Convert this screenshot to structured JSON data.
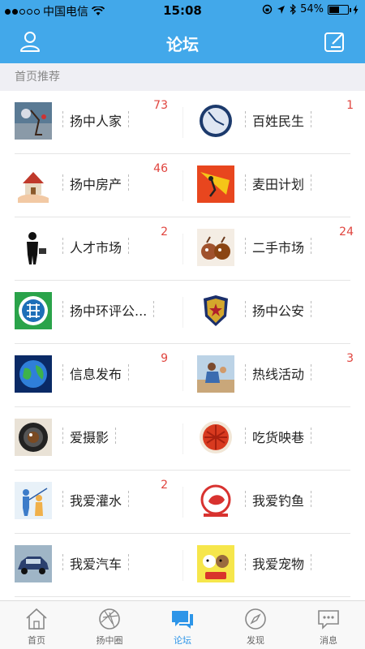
{
  "status": {
    "carrier": "中国电信",
    "time": "15:08",
    "battery": "54%",
    "battery_level": 0.54
  },
  "header": {
    "title": "论坛"
  },
  "section": {
    "title": "首页推荐"
  },
  "forums": [
    {
      "label": "扬中人家",
      "count": "73"
    },
    {
      "label": "百姓民生",
      "count": "1"
    },
    {
      "label": "扬中房产",
      "count": "46"
    },
    {
      "label": "麦田计划",
      "count": ""
    },
    {
      "label": "人才市场",
      "count": "2"
    },
    {
      "label": "二手市场",
      "count": "24"
    },
    {
      "label": "扬中环评公...",
      "count": ""
    },
    {
      "label": "扬中公安",
      "count": ""
    },
    {
      "label": "信息发布",
      "count": "9"
    },
    {
      "label": "热线活动",
      "count": "3"
    },
    {
      "label": "爱摄影",
      "count": ""
    },
    {
      "label": "吃货映巷",
      "count": ""
    },
    {
      "label": "我爱灌水",
      "count": "2"
    },
    {
      "label": "我爱钓鱼",
      "count": ""
    },
    {
      "label": "我爱汽车",
      "count": ""
    },
    {
      "label": "我爱宠物",
      "count": ""
    }
  ],
  "tabs": [
    {
      "label": "首页"
    },
    {
      "label": "扬中圈"
    },
    {
      "label": "论坛"
    },
    {
      "label": "发现"
    },
    {
      "label": "消息"
    }
  ],
  "colors": {
    "brand": "#42a8ea",
    "count": "#e0443e",
    "active_tab": "#2d95e8"
  }
}
